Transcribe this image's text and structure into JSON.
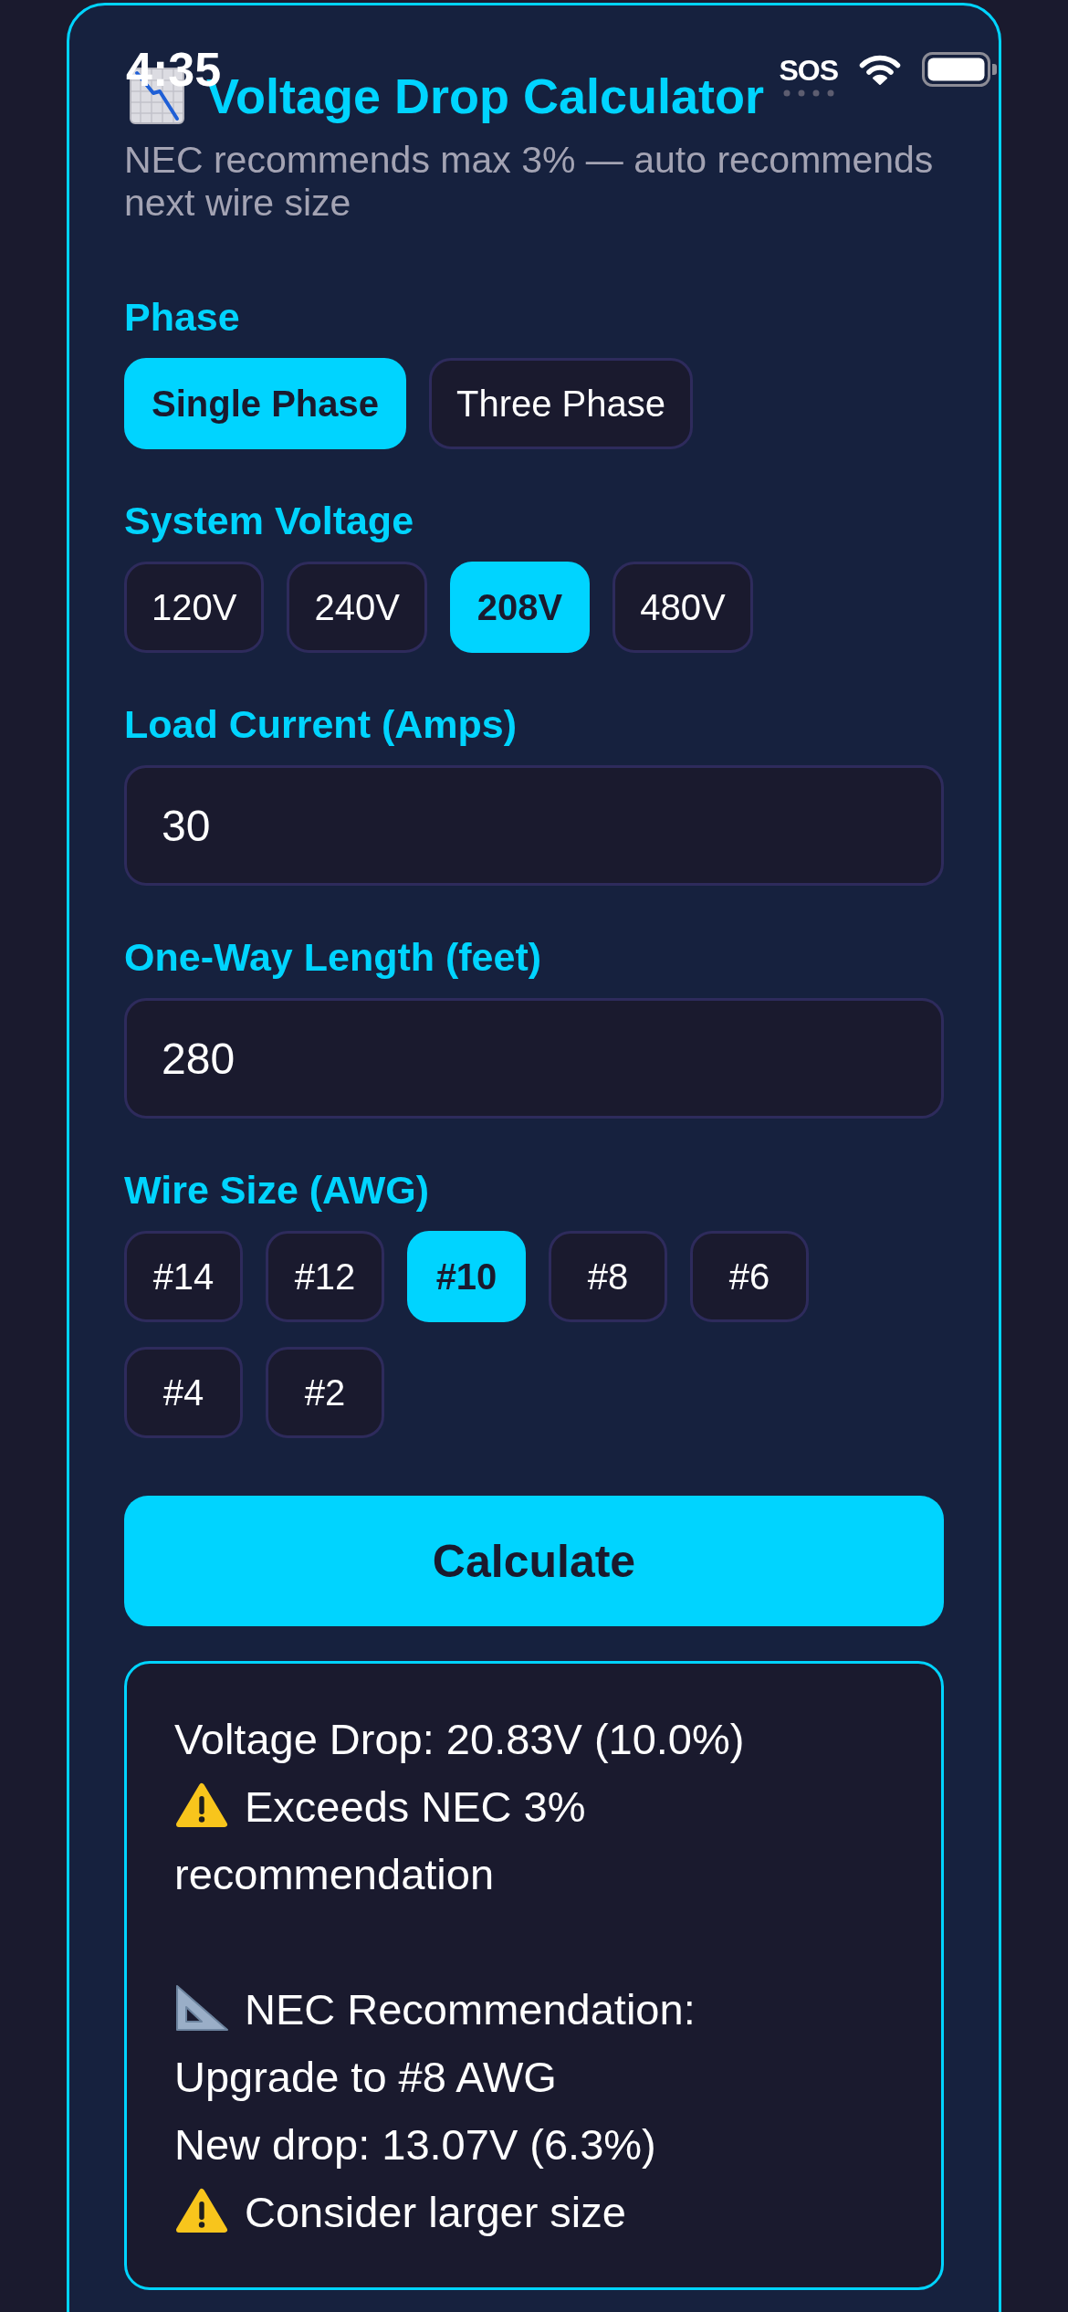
{
  "status_bar": {
    "time": "4:35",
    "network": "SOS"
  },
  "header": {
    "title": "Voltage Drop Calculator",
    "subtitle": "NEC recommends max 3% — auto recommends next wire size"
  },
  "fields": [
    {
      "kind": "choices",
      "label": "Phase",
      "options": [
        {
          "label": "Single Phase",
          "selected": true
        },
        {
          "label": "Three Phase",
          "selected": false
        }
      ]
    },
    {
      "kind": "choices",
      "label": "System Voltage",
      "options": [
        {
          "label": "120V",
          "selected": false
        },
        {
          "label": "240V",
          "selected": false
        },
        {
          "label": "208V",
          "selected": true
        },
        {
          "label": "480V",
          "selected": false
        }
      ]
    },
    {
      "kind": "input",
      "label": "Load Current (Amps)",
      "value": "30"
    },
    {
      "kind": "input",
      "label": "One-Way Length (feet)",
      "value": "280"
    },
    {
      "kind": "choices",
      "label": "Wire Size (AWG)",
      "options": [
        {
          "label": "#14",
          "selected": false
        },
        {
          "label": "#12",
          "selected": false
        },
        {
          "label": "#10",
          "selected": true
        },
        {
          "label": "#8",
          "selected": false
        },
        {
          "label": "#6",
          "selected": false
        },
        {
          "label": "#4",
          "selected": false
        },
        {
          "label": "#2",
          "selected": false
        }
      ]
    }
  ],
  "calculate_button": {
    "label": "Calculate"
  },
  "result": {
    "sections": [
      {
        "lines": [
          {
            "kind": "plain",
            "text": "Voltage Drop: 20.83V (10.0%)"
          },
          {
            "kind": "warning",
            "text": "Exceeds NEC 3%"
          },
          {
            "kind": "plain",
            "text": "recommendation"
          }
        ]
      },
      {
        "lines": [
          {
            "kind": "recommendation",
            "text": "NEC Recommendation:"
          },
          {
            "kind": "plain",
            "text": "Upgrade to #8 AWG"
          },
          {
            "kind": "plain",
            "text": "New drop: 13.07V (6.3%)"
          },
          {
            "kind": "warning",
            "text": "Consider larger size"
          }
        ]
      }
    ]
  }
}
